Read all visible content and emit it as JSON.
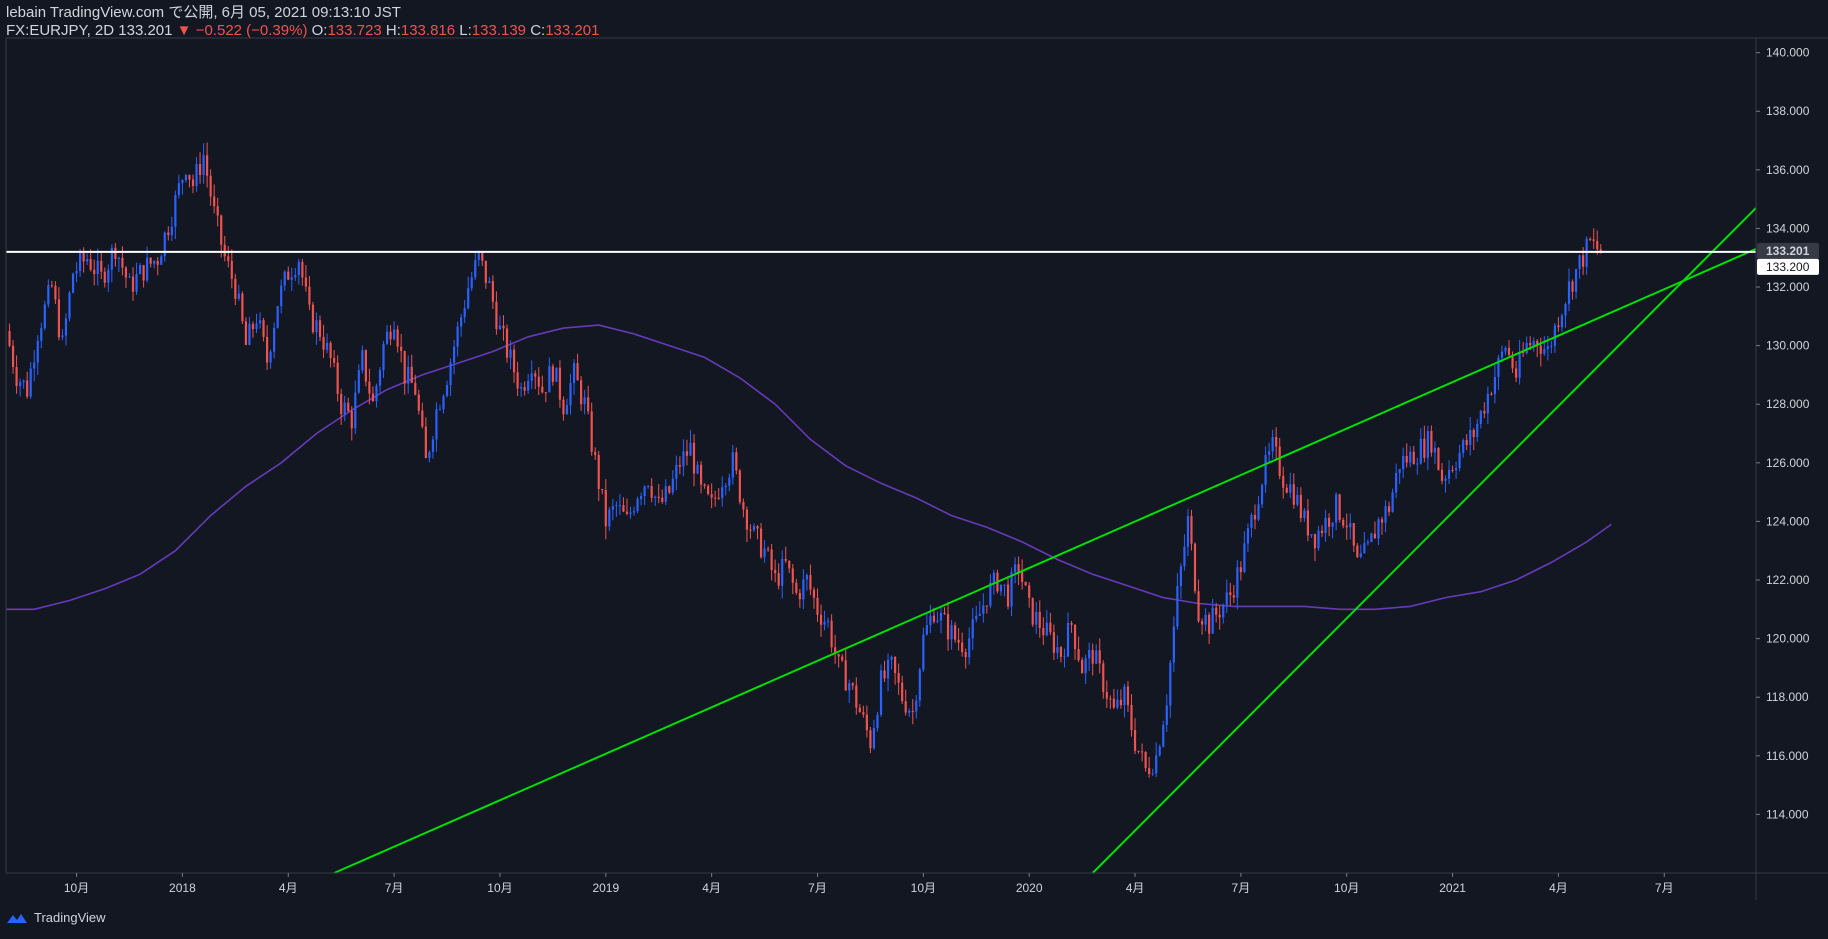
{
  "header": {
    "line1": "lebain TradingView.com で公開, 6月 05, 2021 09:13:10 JST",
    "symbol": "FX:EURJPY, 2D",
    "last": "133.201",
    "change": "−0.522 (−0.39%)",
    "o_label": "O:",
    "o_val": "133.723",
    "h_label": "H:",
    "h_val": "133.816",
    "l_label": "L:",
    "l_val": "133.139",
    "c_label": "C:",
    "c_val": "133.201"
  },
  "footer": {
    "brand": "TradingView"
  },
  "colors": {
    "background": "#131722",
    "up": "#2962ff",
    "down": "#ef5350",
    "ma": "#673ab7",
    "trendline": "#00e000",
    "hline": "#ffffff",
    "axis_text": "#d1d4dc"
  },
  "chart_data": {
    "type": "candlestick",
    "symbol": "EURJPY",
    "ylim": [
      112,
      140.5
    ],
    "y_ticks": [
      "140.000",
      "138.000",
      "136.000",
      "134.000",
      "132.000",
      "130.000",
      "128.000",
      "126.000",
      "124.000",
      "122.000",
      "120.000",
      "118.000",
      "116.000",
      "114.000"
    ],
    "y_tick_values": [
      140,
      138,
      136,
      134,
      132,
      130,
      128,
      126,
      124,
      122,
      120,
      118,
      116,
      114
    ],
    "price_labels": [
      {
        "value": 133.201,
        "text": "133.201",
        "style": "last"
      },
      {
        "value": 133.2,
        "text": "133.200",
        "style": "hline"
      }
    ],
    "x_ticks": [
      {
        "t": 0.7,
        "label": "10月"
      },
      {
        "t": 3.7,
        "label": "2018"
      },
      {
        "t": 6.7,
        "label": "4月"
      },
      {
        "t": 9.7,
        "label": "7月"
      },
      {
        "t": 12.7,
        "label": "10月"
      },
      {
        "t": 15.7,
        "label": "2019"
      },
      {
        "t": 18.7,
        "label": "4月"
      },
      {
        "t": 21.7,
        "label": "7月"
      },
      {
        "t": 24.7,
        "label": "10月"
      },
      {
        "t": 27.7,
        "label": "2020"
      },
      {
        "t": 30.7,
        "label": "4月"
      },
      {
        "t": 33.7,
        "label": "7月"
      },
      {
        "t": 36.7,
        "label": "10月"
      },
      {
        "t": 39.7,
        "label": "2021"
      },
      {
        "t": 42.7,
        "label": "4月"
      },
      {
        "t": 45.7,
        "label": "7月"
      }
    ],
    "x_range": [
      -1.3,
      48.3
    ],
    "price_path": [
      [
        -1.3,
        130.5
      ],
      [
        -1.0,
        129.0
      ],
      [
        -0.7,
        128.5
      ],
      [
        -0.4,
        130.5
      ],
      [
        0.0,
        132.0
      ],
      [
        0.3,
        130.0
      ],
      [
        0.6,
        132.5
      ],
      [
        1.0,
        133.0
      ],
      [
        1.4,
        132.3
      ],
      [
        1.8,
        133.4
      ],
      [
        2.2,
        132.0
      ],
      [
        2.6,
        132.6
      ],
      [
        3.0,
        133.0
      ],
      [
        3.4,
        134.5
      ],
      [
        3.8,
        136.2
      ],
      [
        4.0,
        135.5
      ],
      [
        4.3,
        136.5
      ],
      [
        4.6,
        134.5
      ],
      [
        4.9,
        133.0
      ],
      [
        5.2,
        132.0
      ],
      [
        5.5,
        130.0
      ],
      [
        5.8,
        131.0
      ],
      [
        6.1,
        129.5
      ],
      [
        6.4,
        131.5
      ],
      [
        6.7,
        132.5
      ],
      [
        7.0,
        133.0
      ],
      [
        7.3,
        131.0
      ],
      [
        7.6,
        130.5
      ],
      [
        7.9,
        129.5
      ],
      [
        8.2,
        128.0
      ],
      [
        8.5,
        127.5
      ],
      [
        8.8,
        129.5
      ],
      [
        9.1,
        128.0
      ],
      [
        9.4,
        130.0
      ],
      [
        9.7,
        131.0
      ],
      [
        10.0,
        129.0
      ],
      [
        10.3,
        128.5
      ],
      [
        10.6,
        126.0
      ],
      [
        10.9,
        127.8
      ],
      [
        11.2,
        129.0
      ],
      [
        11.5,
        130.5
      ],
      [
        11.8,
        132.0
      ],
      [
        12.1,
        133.0
      ],
      [
        12.4,
        132.0
      ],
      [
        12.7,
        130.5
      ],
      [
        13.0,
        129.5
      ],
      [
        13.3,
        128.5
      ],
      [
        13.6,
        129.5
      ],
      [
        13.9,
        128.5
      ],
      [
        14.2,
        129.2
      ],
      [
        14.5,
        128.0
      ],
      [
        14.8,
        129.0
      ],
      [
        15.1,
        128.0
      ],
      [
        15.4,
        126.0
      ],
      [
        15.7,
        124.0
      ],
      [
        16.0,
        124.5
      ],
      [
        16.3,
        124.0
      ],
      [
        16.6,
        125.0
      ],
      [
        16.9,
        125.5
      ],
      [
        17.2,
        124.5
      ],
      [
        17.5,
        125.0
      ],
      [
        17.8,
        126.0
      ],
      [
        18.1,
        126.5
      ],
      [
        18.4,
        125.0
      ],
      [
        18.7,
        124.5
      ],
      [
        19.0,
        125.5
      ],
      [
        19.3,
        126.0
      ],
      [
        19.6,
        124.5
      ],
      [
        19.9,
        123.5
      ],
      [
        20.2,
        123.0
      ],
      [
        20.5,
        122.0
      ],
      [
        20.8,
        122.5
      ],
      [
        21.1,
        121.5
      ],
      [
        21.4,
        122.0
      ],
      [
        21.7,
        121.0
      ],
      [
        22.0,
        120.5
      ],
      [
        22.3,
        119.0
      ],
      [
        22.6,
        118.5
      ],
      [
        22.9,
        117.5
      ],
      [
        23.2,
        116.5
      ],
      [
        23.5,
        118.5
      ],
      [
        23.8,
        119.0
      ],
      [
        24.1,
        118.0
      ],
      [
        24.4,
        117.5
      ],
      [
        24.7,
        120.0
      ],
      [
        25.0,
        121.0
      ],
      [
        25.3,
        120.5
      ],
      [
        25.6,
        120.0
      ],
      [
        25.9,
        119.8
      ],
      [
        26.2,
        120.5
      ],
      [
        26.5,
        121.5
      ],
      [
        26.8,
        122.0
      ],
      [
        27.1,
        121.5
      ],
      [
        27.4,
        122.5
      ],
      [
        27.7,
        121.0
      ],
      [
        28.0,
        120.5
      ],
      [
        28.3,
        120.0
      ],
      [
        28.6,
        119.5
      ],
      [
        28.9,
        120.5
      ],
      [
        29.2,
        119.0
      ],
      [
        29.5,
        119.5
      ],
      [
        29.8,
        118.5
      ],
      [
        30.1,
        117.5
      ],
      [
        30.4,
        118.0
      ],
      [
        30.7,
        116.5
      ],
      [
        31.0,
        115.5
      ],
      [
        31.3,
        116.0
      ],
      [
        31.6,
        118.0
      ],
      [
        31.9,
        121.5
      ],
      [
        32.2,
        124.0
      ],
      [
        32.5,
        121.0
      ],
      [
        32.8,
        120.5
      ],
      [
        33.1,
        121.0
      ],
      [
        33.4,
        121.5
      ],
      [
        33.7,
        122.5
      ],
      [
        34.0,
        124.0
      ],
      [
        34.3,
        125.5
      ],
      [
        34.6,
        126.5
      ],
      [
        34.9,
        125.5
      ],
      [
        35.2,
        125.0
      ],
      [
        35.5,
        124.0
      ],
      [
        35.8,
        123.5
      ],
      [
        36.1,
        124.0
      ],
      [
        36.4,
        124.5
      ],
      [
        36.7,
        124.0
      ],
      [
        37.0,
        122.5
      ],
      [
        37.3,
        123.0
      ],
      [
        37.6,
        124.0
      ],
      [
        37.9,
        124.5
      ],
      [
        38.2,
        126.0
      ],
      [
        38.5,
        126.2
      ],
      [
        38.8,
        126.5
      ],
      [
        39.1,
        126.8
      ],
      [
        39.4,
        125.5
      ],
      [
        39.7,
        126.0
      ],
      [
        40.0,
        126.5
      ],
      [
        40.3,
        127.0
      ],
      [
        40.6,
        128.0
      ],
      [
        40.9,
        129.0
      ],
      [
        41.2,
        130.0
      ],
      [
        41.5,
        129.0
      ],
      [
        41.8,
        130.0
      ],
      [
        42.1,
        130.2
      ],
      [
        42.4,
        129.8
      ],
      [
        42.7,
        131.0
      ],
      [
        43.0,
        132.0
      ],
      [
        43.3,
        132.8
      ],
      [
        43.6,
        133.5
      ],
      [
        43.9,
        133.2
      ]
    ],
    "moving_average": [
      [
        -1.3,
        121.0
      ],
      [
        -0.5,
        121.0
      ],
      [
        0.5,
        121.3
      ],
      [
        1.5,
        121.7
      ],
      [
        2.5,
        122.2
      ],
      [
        3.5,
        123.0
      ],
      [
        4.5,
        124.2
      ],
      [
        5.5,
        125.2
      ],
      [
        6.5,
        126.0
      ],
      [
        7.5,
        127.0
      ],
      [
        8.5,
        127.8
      ],
      [
        9.5,
        128.5
      ],
      [
        10.5,
        129.0
      ],
      [
        11.5,
        129.4
      ],
      [
        12.5,
        129.8
      ],
      [
        13.5,
        130.3
      ],
      [
        14.5,
        130.6
      ],
      [
        15.5,
        130.7
      ],
      [
        16.5,
        130.4
      ],
      [
        17.5,
        130.0
      ],
      [
        18.5,
        129.6
      ],
      [
        19.5,
        128.9
      ],
      [
        20.5,
        128.0
      ],
      [
        21.5,
        126.8
      ],
      [
        22.5,
        125.9
      ],
      [
        23.5,
        125.3
      ],
      [
        24.5,
        124.8
      ],
      [
        25.5,
        124.2
      ],
      [
        26.5,
        123.8
      ],
      [
        27.5,
        123.3
      ],
      [
        28.5,
        122.7
      ],
      [
        29.5,
        122.2
      ],
      [
        30.5,
        121.8
      ],
      [
        31.5,
        121.4
      ],
      [
        32.5,
        121.2
      ],
      [
        33.5,
        121.1
      ],
      [
        34.5,
        121.1
      ],
      [
        35.5,
        121.1
      ],
      [
        36.5,
        121.0
      ],
      [
        37.5,
        121.0
      ],
      [
        38.5,
        121.1
      ],
      [
        39.5,
        121.4
      ],
      [
        40.5,
        121.6
      ],
      [
        41.5,
        122.0
      ],
      [
        42.5,
        122.6
      ],
      [
        43.5,
        123.3
      ],
      [
        44.2,
        123.9
      ]
    ],
    "trendlines": [
      {
        "from": [
          8.0,
          112.0
        ],
        "to": [
          48.3,
          133.3
        ]
      },
      {
        "from": [
          29.5,
          112.0
        ],
        "to": [
          48.3,
          134.7
        ]
      }
    ],
    "horizontal_line": 133.2
  }
}
